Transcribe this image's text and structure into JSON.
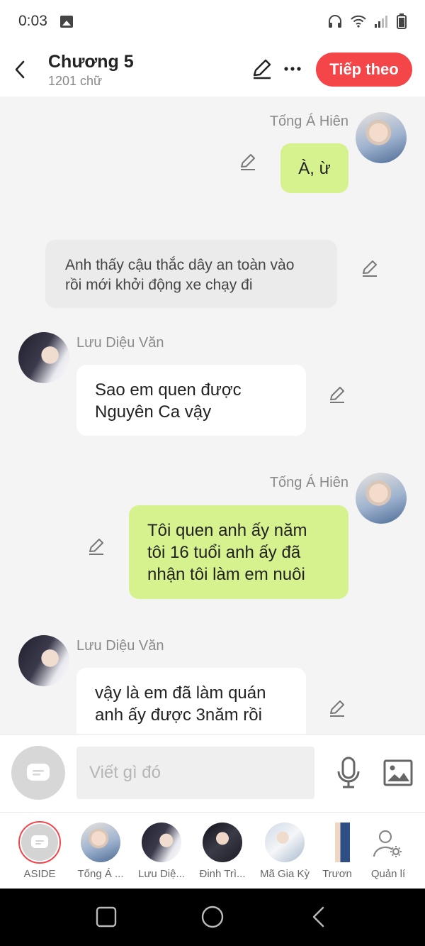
{
  "status_bar": {
    "time": "0:03"
  },
  "header": {
    "title": "Chương 5",
    "word_count": "1201 chữ",
    "next_label": "Tiếp theo",
    "accent_color": "#f44549"
  },
  "messages": [
    {
      "type": "dialogue",
      "side": "right",
      "sender": "Tống Á Hiên",
      "text": "À, ừ",
      "bubble_color": "#d6f28f"
    },
    {
      "type": "narration",
      "text_lines": [
        "Anh thấy cậu thắc dây an toàn vào",
        "rồi mới khởi động xe chạy đi"
      ]
    },
    {
      "type": "dialogue",
      "side": "left",
      "sender": "Lưu Diệu Văn",
      "text_lines": [
        "Sao em quen được",
        "Nguyên Ca vậy"
      ]
    },
    {
      "type": "dialogue",
      "side": "right",
      "sender": "Tống Á Hiên",
      "text_lines": [
        "Tôi quen anh ấy năm",
        "tôi 16 tuổi anh ấy đã",
        "nhận tôi làm em nuôi"
      ],
      "bubble_color": "#d6f28f"
    },
    {
      "type": "dialogue",
      "side": "left",
      "sender": "Lưu Diệu Văn",
      "text_lines": [
        "vậy là em đã làm quán",
        "anh ấy được 3năm rồi"
      ]
    }
  ],
  "composer": {
    "placeholder": "Viết gì đó"
  },
  "characters": [
    {
      "label": "ASIDE",
      "icon": "aside-icon"
    },
    {
      "label": "Tống Á ..."
    },
    {
      "label": "Lưu Diệ..."
    },
    {
      "label": "Đinh Trì..."
    },
    {
      "label": "Mã Gia Kỳ"
    },
    {
      "label": "Trươn"
    },
    {
      "label": "Quản lí",
      "icon": "manage-icon"
    }
  ]
}
